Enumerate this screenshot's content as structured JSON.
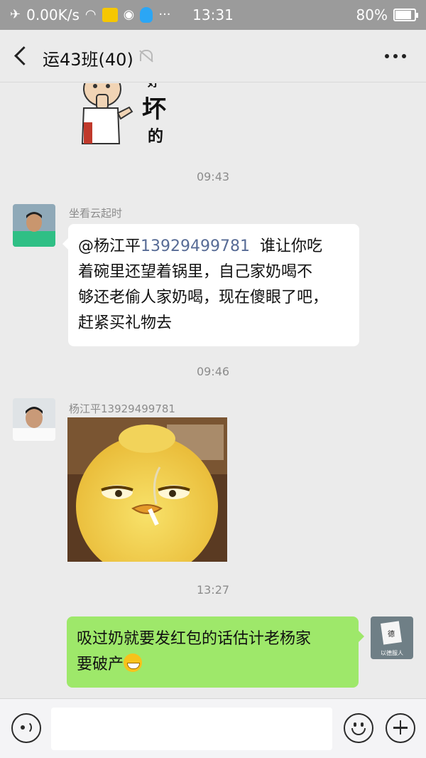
{
  "status_bar": {
    "airplane_icon": "airplane-icon",
    "net_speed": "0.00K/s",
    "time": "13:31",
    "battery_percent": "80%",
    "battery_level": 0.8
  },
  "header": {
    "title": "运43班(40)",
    "back_icon": "back-arrow-icon",
    "mute_icon": "bell-muted-icon",
    "more_icon": "more-dots-icon"
  },
  "messages": [
    {
      "type": "time",
      "text": "09:43"
    },
    {
      "type": "text",
      "side": "left",
      "sender": "坐看云起时",
      "mention": "@杨江平",
      "phone": "13929499781",
      "line1_rest": "谁让你吃",
      "line2": "着碗里还望着锅里，自己家奶喝不",
      "line3": "够还老偷人家奶喝，现在傻眼了吧，",
      "line4": "赶紧买礼物去"
    },
    {
      "type": "time",
      "text": "09:46"
    },
    {
      "type": "image",
      "side": "left",
      "sender": "杨江平13929499781"
    },
    {
      "type": "time",
      "text": "13:27"
    },
    {
      "type": "text",
      "side": "right",
      "line1": "吸过奶就要发红包的话估计老杨家",
      "line2": "要破产",
      "emoji": "grin-emoji"
    }
  ],
  "sticker_text": {
    "a": "好",
    "b": "坏",
    "c": "的"
  },
  "self_avatar_caption": "以德服人",
  "input_bar": {
    "voice_icon": "voice-icon",
    "text_value": "",
    "emoji_icon": "smile-icon",
    "plus_icon": "plus-icon"
  }
}
